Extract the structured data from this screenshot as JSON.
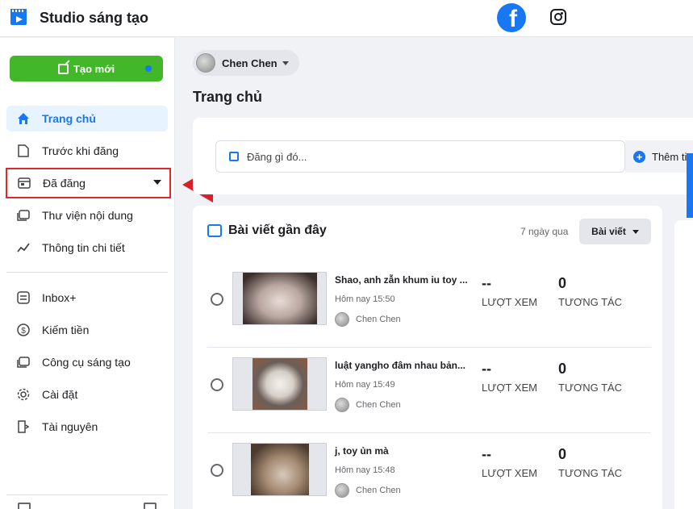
{
  "app": {
    "title": "Studio sáng tạo"
  },
  "header": {
    "fb_icon": "facebook-icon",
    "ig_icon": "instagram-icon"
  },
  "sidebar": {
    "create_label": "Tạo mới",
    "items": [
      {
        "label": "Trang chủ",
        "icon": "home-icon"
      },
      {
        "label": "Trước khi đăng",
        "icon": "document-icon"
      },
      {
        "label": "Đã đăng",
        "icon": "posts-icon"
      },
      {
        "label": "Thư viện nội dung",
        "icon": "library-icon"
      },
      {
        "label": "Thông tin chi tiết",
        "icon": "insights-icon"
      },
      {
        "label": "Inbox+",
        "icon": "inbox-icon"
      },
      {
        "label": "Kiếm tiền",
        "icon": "dollar-icon"
      },
      {
        "label": "Công cụ sáng tạo",
        "icon": "tools-icon"
      },
      {
        "label": "Cài đặt",
        "icon": "settings-icon"
      },
      {
        "label": "Tài nguyên",
        "icon": "resources-icon"
      }
    ]
  },
  "main": {
    "page_name": "Chen Chen",
    "title": "Trang chủ",
    "compose_placeholder": "Đăng gì đó...",
    "compose_add": "Thêm ti",
    "recent": {
      "title": "Bài viết gần đây",
      "range": "7 ngày qua",
      "filter": "Bài viết",
      "views_label": "LƯỢT XEM",
      "engage_label": "TƯƠNG TÁC",
      "posts": [
        {
          "title": "Shao, anh zẫn khum iu toy ...",
          "time": "Hôm nay 15:50",
          "author": "Chen Chen",
          "views": "--",
          "engagement": "0"
        },
        {
          "title": "luật yangho đâm nhau bản...",
          "time": "Hôm nay 15:49",
          "author": "Chen Chen",
          "views": "--",
          "engagement": "0"
        },
        {
          "title": "j, toy ủn mà",
          "time": "Hôm nay 15:48",
          "author": "Chen Chen",
          "views": "--",
          "engagement": "0"
        }
      ]
    }
  },
  "colors": {
    "primary": "#1877f2",
    "create": "#42b72a",
    "highlight": "#e0282b"
  }
}
